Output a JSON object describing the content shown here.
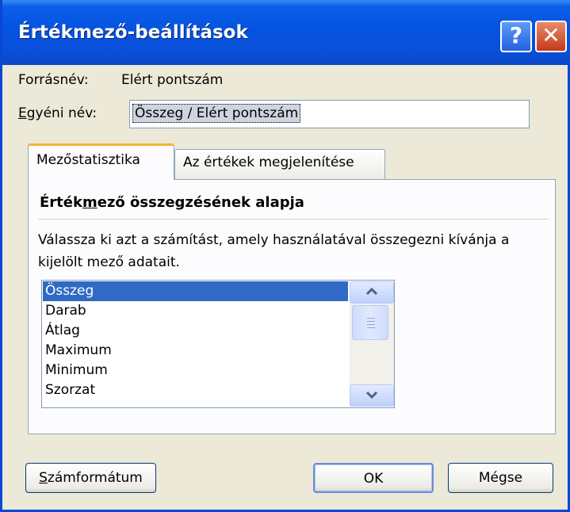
{
  "window": {
    "title": "Értékmező-beállítások",
    "help_label": "?",
    "close_label": "✕"
  },
  "source": {
    "label": "Forrásnév:",
    "value": "Elért pontszám"
  },
  "custom_name": {
    "label_underlined": "E",
    "label_rest": "gyéni név:",
    "value": "Összeg / Elért pontszám"
  },
  "tabs": [
    {
      "label": "Mezőstatisztika",
      "active": true
    },
    {
      "label": "Az értékek megjelenítése",
      "active": false
    }
  ],
  "panel": {
    "heading_pre": "Érték",
    "heading_underlined": "m",
    "heading_post": "ező összegzésének alapja",
    "description": "Válassza ki azt a számítást, amely használatával összegezni kívánja a kijelölt mező adatait.",
    "items": [
      "Összeg",
      "Darab",
      "Átlag",
      "Maximum",
      "Minimum",
      "Szorzat"
    ],
    "selected_index": 0
  },
  "buttons": {
    "number_format_underlined": "S",
    "number_format_rest": "zámformátum",
    "ok": "OK",
    "cancel": "Mégse"
  }
}
